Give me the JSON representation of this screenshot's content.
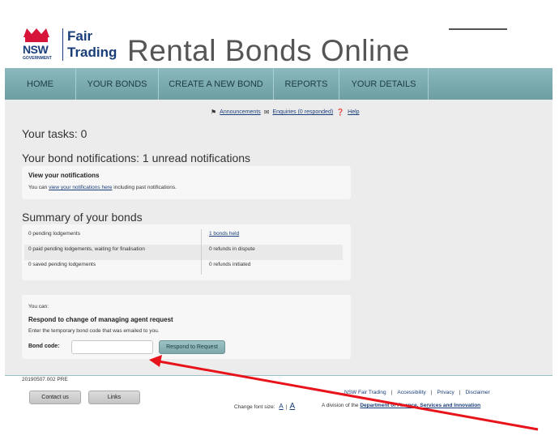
{
  "header": {
    "logo_nsw": "NSW",
    "logo_gov": "GOVERNMENT",
    "logo_fair": "Fair",
    "logo_trading": "Trading",
    "site_title": "Rental Bonds Online",
    "brand_red": "#d7153a",
    "brand_navy": "#1a3e7a"
  },
  "nav": {
    "items": [
      {
        "label": "HOME"
      },
      {
        "label": "YOUR BONDS"
      },
      {
        "label": "CREATE A NEW BOND"
      },
      {
        "label": "REPORTS"
      },
      {
        "label": "YOUR DETAILS"
      },
      {
        "label": ""
      }
    ],
    "color": "#7aabaf"
  },
  "links_bar": {
    "announcements": "Announcements",
    "enquiries": "Enquiries (0 responded)",
    "help": "Help",
    "icons": [
      "megaphone-icon",
      "envelope-icon",
      "help-icon"
    ]
  },
  "tasks": {
    "heading": "Your tasks: 0"
  },
  "notifications": {
    "heading": "Your bond notifications: 1 unread notifications",
    "panel_title": "View your notifications",
    "text_before": "You can ",
    "link": "view your notifications here",
    "text_after": " including past notifications."
  },
  "summary": {
    "heading": "Summary of your bonds",
    "left": [
      "0 pending lodgements",
      "0 paid pending lodgements, waiting for finalisation",
      "0 saved pending lodgements"
    ],
    "right_link": "1 bonds held",
    "right": [
      "0 refunds in dispute",
      "0 refunds initiated"
    ]
  },
  "request": {
    "you_can": "You can:",
    "title": "Respond to change of managing agent request",
    "instruction": "Enter the temporary bond code that was emailed to you.",
    "field_label": "Bond code:",
    "field_value": "",
    "button_label": "Respond to Request"
  },
  "footer": {
    "version": "20190507.002 PRE",
    "contact_btn": "Contact us",
    "links_btn": "Links",
    "links": [
      "NSW Fair Trading",
      "Accessibility",
      "Privacy",
      "Disclaimer"
    ],
    "font_size_label": "Change font size:",
    "font_a_small": "A",
    "font_a_large": "A",
    "division_prefix": "A division of the ",
    "division_name": "Department of Finance, Services and Innovation"
  },
  "annotation": {
    "arrow_color": "#e8141c"
  }
}
